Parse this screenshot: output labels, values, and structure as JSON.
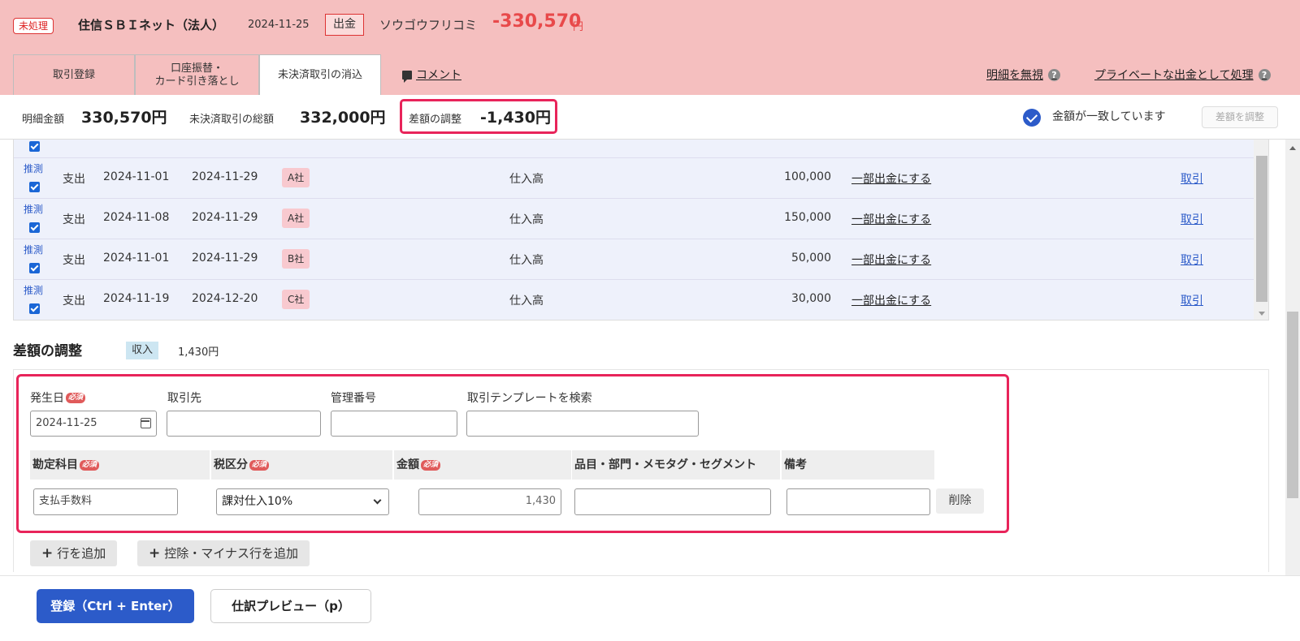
{
  "header": {
    "status_badge": "未処理",
    "bank_name": "住信ＳＢＩネット（法人）",
    "date": "2024-11-25",
    "type_badge": "出金",
    "description": "ソウゴウフリコミ",
    "amount": "-330,570",
    "yen": "円"
  },
  "tabs": [
    {
      "label": "取引登録"
    },
    {
      "label": "口座振替・\nカード引き落とし"
    },
    {
      "label": "未決済取引の消込"
    }
  ],
  "comment_link": "コメント",
  "links": {
    "ignore": "明細を無視",
    "private": "プライベートな出金として処理"
  },
  "summary": {
    "detail_label": "明細金額",
    "detail_value": "330,570円",
    "unsettled_label": "未決済取引の総額",
    "unsettled_value": "332,000円",
    "diff_label": "差額の調整",
    "diff_value": "-1,430円",
    "match_text": "金額が一致しています",
    "adjust_button": "差額を調整"
  },
  "table": {
    "guess_label": "推測",
    "partial_label": "一部出金にする",
    "deal_label": "取引",
    "rows": [
      {
        "kind": "支出",
        "issue_date": "2024-11-01",
        "due_date": "2024-11-29",
        "partner": "A社",
        "account": "仕入高",
        "amount": "100,000"
      },
      {
        "kind": "支出",
        "issue_date": "2024-11-08",
        "due_date": "2024-11-29",
        "partner": "A社",
        "account": "仕入高",
        "amount": "150,000"
      },
      {
        "kind": "支出",
        "issue_date": "2024-11-01",
        "due_date": "2024-11-29",
        "partner": "B社",
        "account": "仕入高",
        "amount": "50,000"
      },
      {
        "kind": "支出",
        "issue_date": "2024-11-19",
        "due_date": "2024-12-20",
        "partner": "C社",
        "account": "仕入高",
        "amount": "30,000"
      }
    ]
  },
  "adjustment": {
    "title": "差額の調整",
    "income_tag": "収入",
    "income_amount": "1,430円",
    "required": "必須",
    "fields": {
      "date_label": "発生日",
      "date_value": "2024-11-25",
      "partner_label": "取引先",
      "partner_value": "",
      "mgmt_label": "管理番号",
      "mgmt_value": "",
      "template_label": "取引テンプレートを検索",
      "template_value": ""
    },
    "columns": {
      "account": "勘定科目",
      "tax": "税区分",
      "amount": "金額",
      "item": "品目・部門・メモタグ・セグメント",
      "note": "備考"
    },
    "line": {
      "account": "支払手数料",
      "tax": "課対仕入10%",
      "amount": "1,430",
      "item": "",
      "note": "",
      "delete": "削除"
    },
    "add_row": "行を追加",
    "add_minus_row": "控除・マイナス行を追加"
  },
  "footer": {
    "register": "登録（Ctrl + Enter）",
    "preview": "仕訳プレビュー（p）"
  },
  "colors": {
    "header_bg": "#f5bfbf",
    "accent_red": "#e8494a",
    "highlight": "#e8245a",
    "primary_blue": "#2c5bc9",
    "table_bg": "#eef1fb"
  }
}
